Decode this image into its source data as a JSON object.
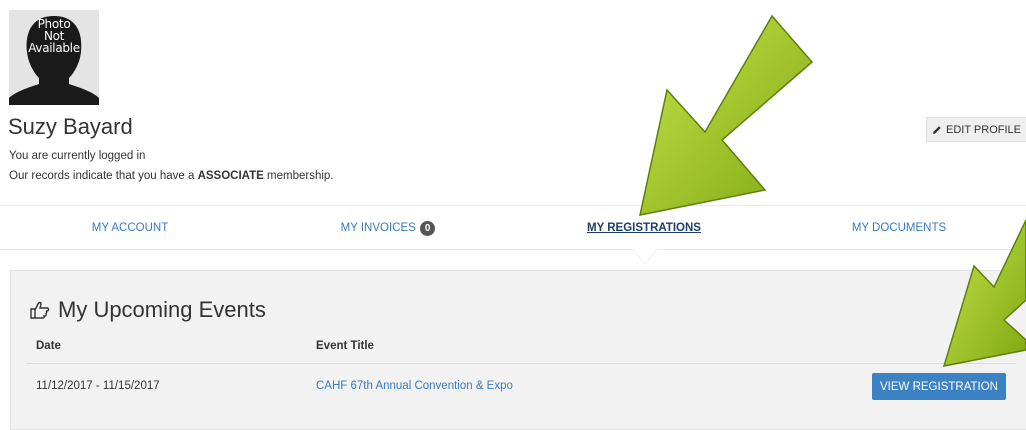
{
  "profile": {
    "photo_placeholder": [
      "Photo",
      "Not",
      "Available"
    ],
    "name": "Suzy Bayard",
    "status_text": "You are currently logged in",
    "membership_prefix": "Our records indicate that you have a ",
    "membership_type": "ASSOCIATE",
    "membership_suffix": " membership.",
    "edit_button": "EDIT PROFILE",
    "edit_icon": "pencil-icon"
  },
  "tabs": [
    {
      "label": "MY ACCOUNT",
      "active": false
    },
    {
      "label": "MY INVOICES",
      "badge": "0",
      "active": false
    },
    {
      "label": "MY REGISTRATIONS",
      "active": true
    },
    {
      "label": "MY DOCUMENTS",
      "active": false
    }
  ],
  "events": {
    "title": "My Upcoming Events",
    "title_icon": "hand-pointing-right-icon",
    "columns": [
      "Date",
      "Event Title"
    ],
    "rows": [
      {
        "date": "11/12/2017 - 11/15/2017",
        "title": "CAHF 67th Annual Convention & Expo",
        "action": "VIEW REGISTRATION"
      }
    ]
  },
  "colors": {
    "link": "#3a7bbf",
    "button": "#3a82c4",
    "arrow": "#99c31c"
  }
}
